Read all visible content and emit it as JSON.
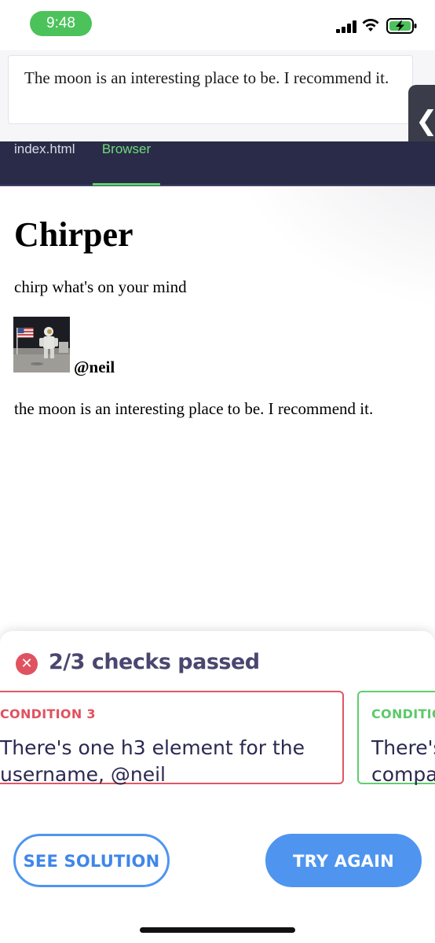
{
  "status_bar": {
    "time": "9:48"
  },
  "top_card": {
    "text": "The moon is an interesting place to be. I recommend it."
  },
  "side_handle": {
    "glyph": "❮"
  },
  "tabs": [
    {
      "label": "index.html",
      "active": false
    },
    {
      "label": "Browser",
      "active": true
    }
  ],
  "browser": {
    "heading": "Chirper",
    "tagline": "chirp what's on your mind",
    "avatar_icon": "astronaut-photo",
    "username": "@neil",
    "post": "the moon is an interesting place to be. I recommend it."
  },
  "results": {
    "status_icon": "x-circle-icon",
    "summary": "2/3 checks passed",
    "conditions": [
      {
        "label": "CONDITION 3",
        "text": "There's one h3 element for the\nusername, @neil",
        "status": "failed",
        "color": "#e15763"
      },
      {
        "label": "CONDITIO",
        "text": "There's\ncompa",
        "status": "passed",
        "color": "#5fcf6c"
      }
    ],
    "buttons": {
      "see_solution": "SEE SOLUTION",
      "try_again": "TRY AGAIN"
    }
  },
  "colors": {
    "accent_blue": "#4f95f0",
    "tab_bar": "#2a2b48",
    "active_tab": "#6fdc7c",
    "error": "#e0525f",
    "success": "#5fcf6c",
    "time_pill": "#4cc25b"
  }
}
